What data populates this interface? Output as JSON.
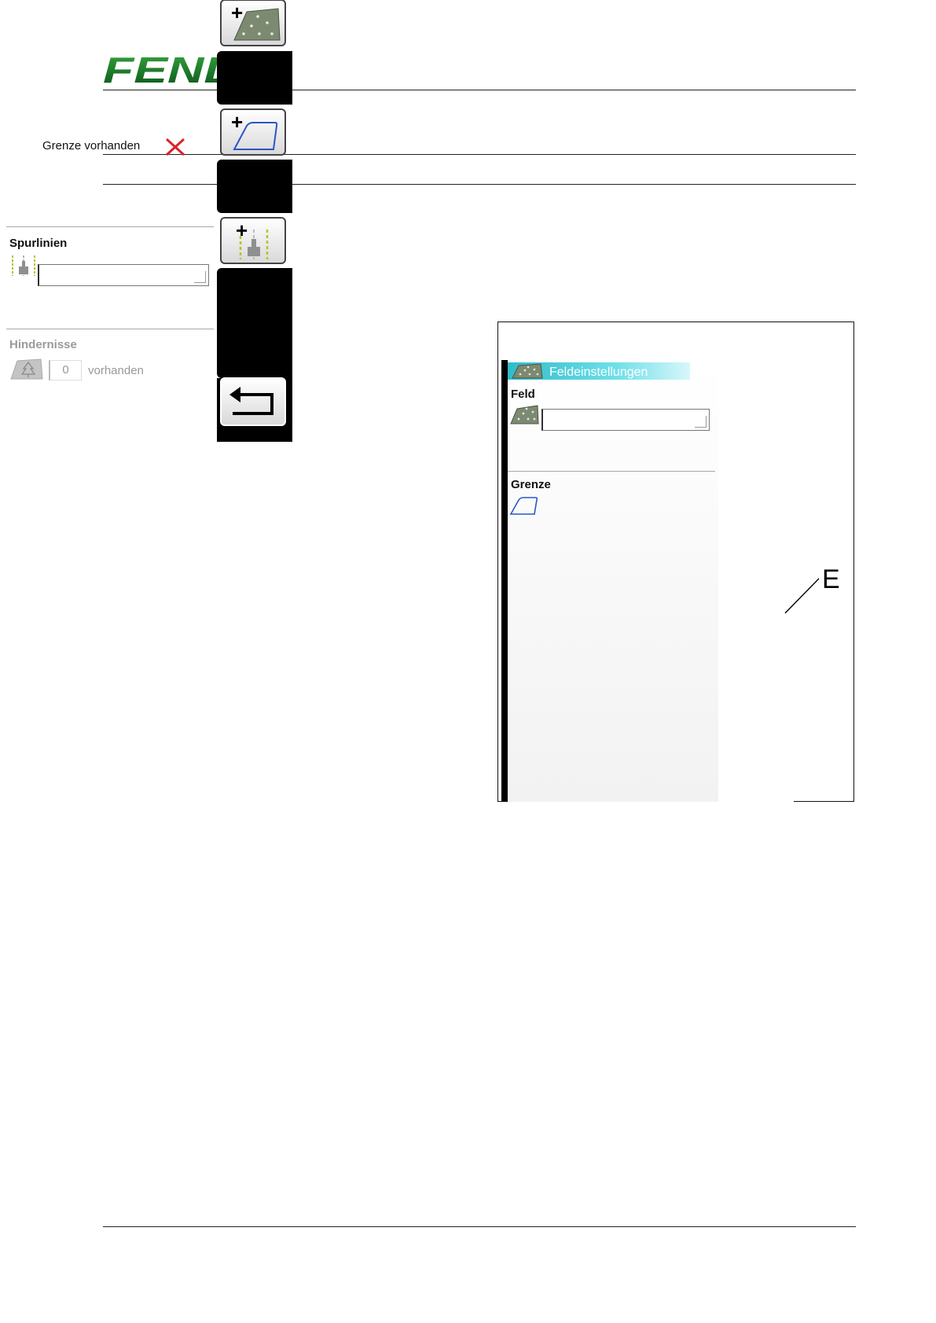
{
  "brand": {
    "logo_text": "FENDT",
    "logo_color": "#1a7a2a"
  },
  "screen": {
    "title": "Feldeinstellungen",
    "sections": {
      "feld": {
        "label": "Feld",
        "field_value": ""
      },
      "grenze": {
        "label": "Grenze",
        "status": "Grenze vorhanden"
      },
      "spurlinien": {
        "label": "Spurlinien",
        "field_value": ""
      },
      "hindernisse": {
        "label": "Hindernisse",
        "count": "0",
        "suffix": "vorhanden"
      }
    }
  },
  "callout": {
    "label": "E"
  },
  "icons": {
    "field": "field-icon",
    "boundary": "boundary-icon",
    "tracklines": "tracklines-icon",
    "obstacle": "obstacle-icon",
    "delete": "delete-x-icon",
    "back": "back-arrow-icon"
  }
}
